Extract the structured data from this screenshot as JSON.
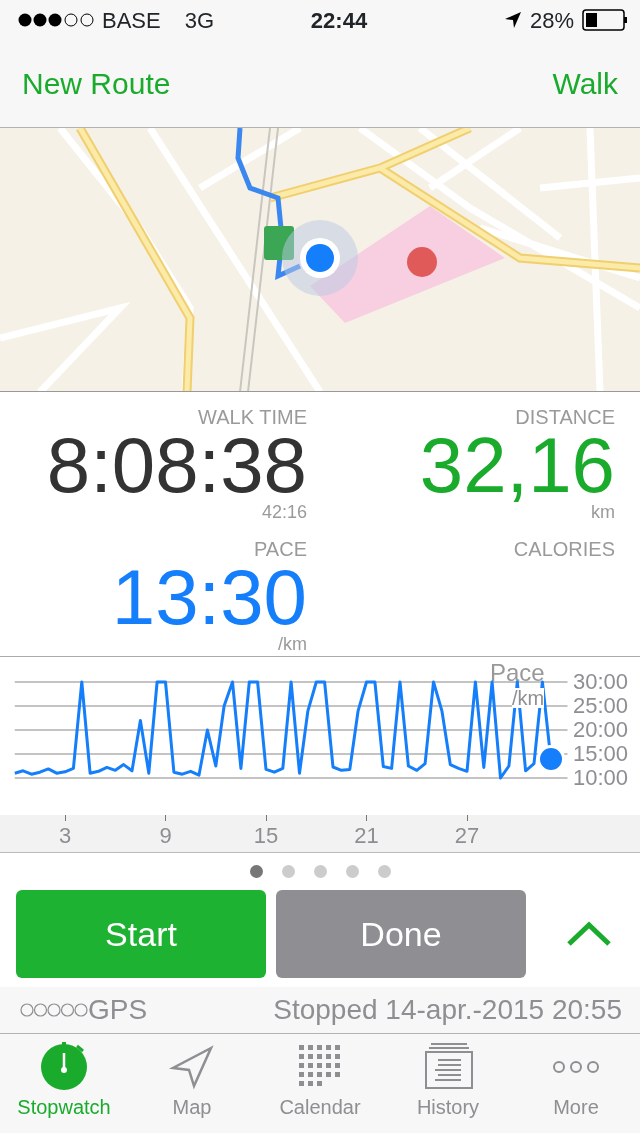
{
  "status_bar": {
    "carrier": "BASE",
    "network": "3G",
    "time": "22:44",
    "battery": "28%"
  },
  "nav": {
    "left": "New Route",
    "right": "Walk"
  },
  "stats": [
    {
      "label": "WALK TIME",
      "value": "8:08:38",
      "unit": "42:16",
      "color": "#333333"
    },
    {
      "label": "DISTANCE",
      "value": "32,16",
      "unit": "km",
      "color": "#1aab2c"
    },
    {
      "label": "PACE",
      "value": "13:30",
      "unit": "/km",
      "color": "#157efb"
    },
    {
      "label": "CALORIES"
    }
  ],
  "chart": {
    "chart_data": {
      "type": "line",
      "title": "Pace",
      "ylabel": "/km",
      "x": [
        0,
        0.5,
        1,
        1.5,
        2,
        2.5,
        3,
        3.5,
        4,
        4.5,
        5,
        5.5,
        6,
        6.5,
        7,
        7.5,
        8,
        8.5,
        9,
        9.5,
        10,
        10.5,
        11,
        11.5,
        12,
        12.5,
        13,
        13.5,
        14,
        14.5,
        15,
        15.5,
        16,
        16.5,
        17,
        17.5,
        18,
        18.5,
        19,
        19.5,
        20,
        20.5,
        21,
        21.5,
        22,
        22.5,
        23,
        23.5,
        24,
        24.5,
        25,
        25.5,
        26,
        26.5,
        27,
        27.5,
        28,
        28.5,
        29,
        29.5,
        30,
        30.5,
        31,
        31.5,
        32
      ],
      "series": [
        {
          "color": "#157efb",
          "values": [
            11,
            11.5,
            10.8,
            11.2,
            11.9,
            11,
            11.3,
            12,
            30,
            11,
            11.4,
            12.2,
            11.6,
            12.8,
            11.5,
            22,
            11,
            30,
            30,
            11.2,
            10.8,
            11.4,
            10.6,
            20,
            12.5,
            25,
            30,
            12,
            30,
            30,
            11.8,
            11.2,
            12,
            30,
            11,
            24,
            30,
            30,
            12.3,
            11.6,
            11.8,
            24,
            30,
            30,
            12.4,
            12,
            30,
            12.5,
            11.6,
            13,
            30,
            24,
            12.8,
            12,
            11.4,
            30,
            12.2,
            30,
            10,
            12.5,
            30,
            11.5,
            13,
            30,
            14
          ]
        }
      ],
      "grid": true,
      "xlim": [
        0,
        33
      ],
      "ylim": [
        10,
        30
      ],
      "xticks": [
        3,
        9,
        15,
        21,
        27
      ],
      "yticks": [
        {
          "value": 30,
          "label": "30:00"
        },
        {
          "value": 25,
          "label": "25:00"
        },
        {
          "value": 20,
          "label": "20:00"
        },
        {
          "value": 15,
          "label": "15:00"
        },
        {
          "value": 10,
          "label": "10:00"
        }
      ]
    }
  },
  "pages": [
    {
      "selected": true
    },
    {
      "selected": false
    },
    {
      "selected": false
    },
    {
      "selected": false
    },
    {
      "selected": false
    }
  ],
  "buttons": [
    {
      "label": "Start",
      "kind": "start"
    },
    {
      "label": "Done",
      "kind": "done"
    }
  ],
  "gps": {
    "label": "GPS",
    "status": "Stopped 14-apr.-2015 20:55"
  },
  "tabs": [
    {
      "label": "Stopwatch",
      "selected": true
    },
    {
      "label": "Map",
      "selected": false
    },
    {
      "label": "Calendar",
      "selected": false
    },
    {
      "label": "History",
      "selected": false
    },
    {
      "label": "More",
      "selected": false
    }
  ]
}
